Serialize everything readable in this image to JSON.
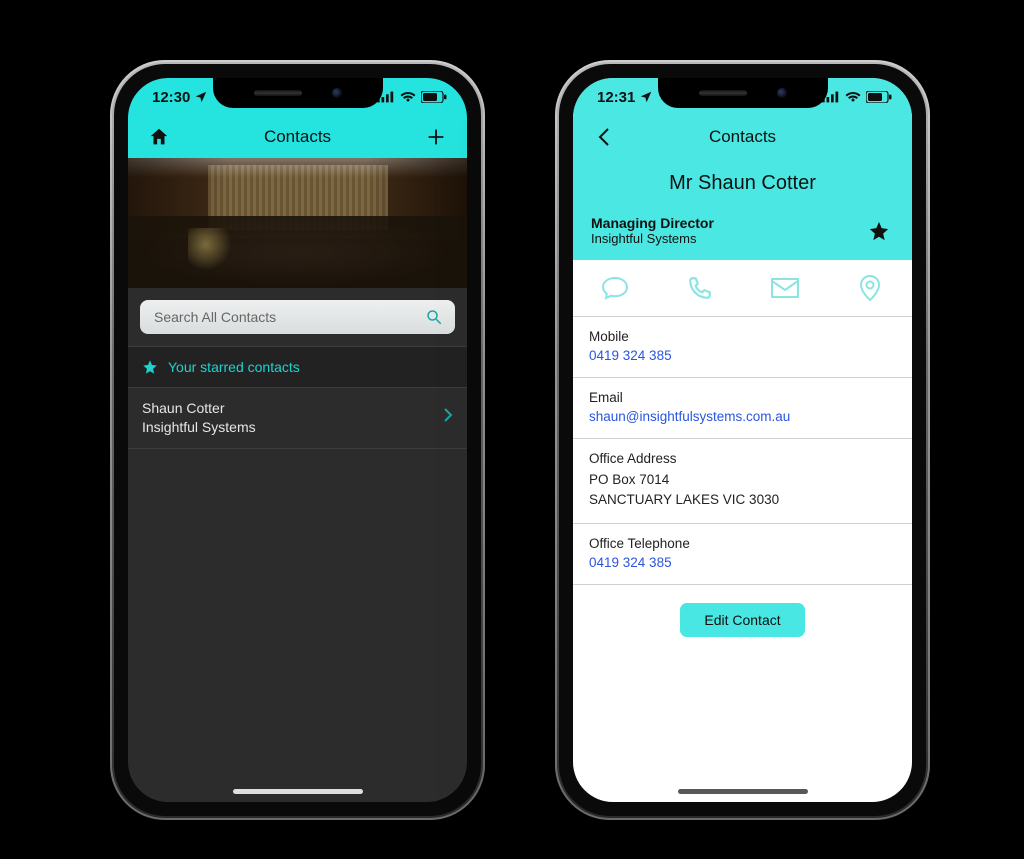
{
  "theme": {
    "accent": "#25e4df",
    "link": "#2a55e0"
  },
  "phone1": {
    "status": {
      "time": "12:30"
    },
    "header": {
      "title": "Contacts"
    },
    "search": {
      "placeholder": "Search All Contacts"
    },
    "starred": {
      "label": "Your starred contacts"
    },
    "contacts": [
      {
        "name": "Shaun Cotter",
        "company": "Insightful Systems"
      }
    ]
  },
  "phone2": {
    "status": {
      "time": "12:31"
    },
    "header": {
      "title": "Contacts"
    },
    "person": {
      "full_name": "Mr Shaun Cotter",
      "role": "Managing Director",
      "company": "Insightful Systems"
    },
    "details": {
      "mobile": {
        "label": "Mobile",
        "value": "0419 324 385"
      },
      "email": {
        "label": "Email",
        "value": "shaun@insightfulsystems.com.au"
      },
      "address": {
        "label": "Office Address",
        "line1": "PO Box 7014",
        "line2": "SANCTUARY LAKES VIC 3030"
      },
      "office_tel": {
        "label": "Office Telephone",
        "value": "0419 324 385"
      }
    },
    "edit_button": "Edit Contact"
  }
}
